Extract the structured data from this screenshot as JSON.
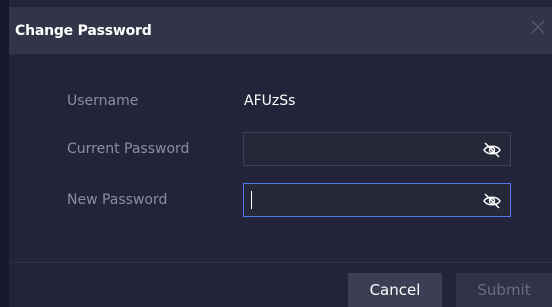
{
  "dialog": {
    "title": "Change Password"
  },
  "form": {
    "username_label": "Username",
    "username_value": "AFUzSs",
    "current_password_label": "Current Password",
    "current_password_value": "",
    "new_password_label": "New Password",
    "new_password_value": ""
  },
  "footer": {
    "cancel_label": "Cancel",
    "submit_label": "Submit"
  },
  "colors": {
    "accent": "#4f79f2",
    "background": "#22253a",
    "titlebar": "#323548"
  },
  "icons": {
    "close": "close-icon",
    "toggle_visibility": "eye-off-icon"
  }
}
